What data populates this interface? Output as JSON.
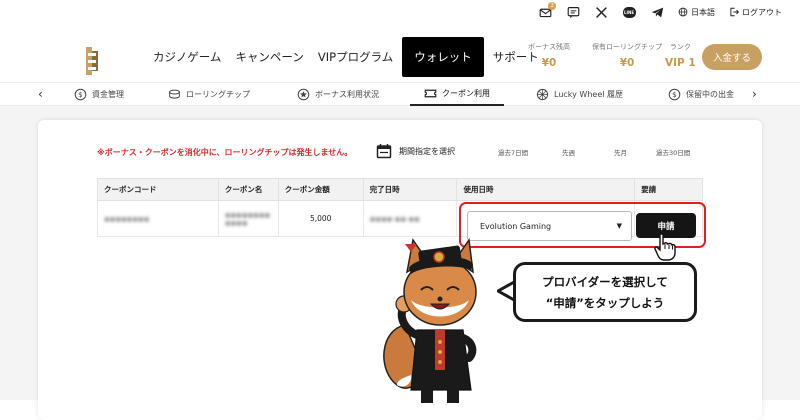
{
  "topbar": {
    "mail_badge": "3",
    "language_label": "日本語",
    "logout_label": "ログアウト"
  },
  "nav": {
    "items": [
      "カジノゲーム",
      "キャンペーン",
      "VIPプログラム",
      "ウォレット",
      "サポート"
    ],
    "active": "ウォレット"
  },
  "balances": {
    "bonus_credit": {
      "label": "ボーナス残高",
      "value": "¥0"
    },
    "rolling_chip": {
      "label": "保有ローリングチップ",
      "value": "¥0"
    },
    "rank": {
      "label": "ランク",
      "value": "VIP 1"
    }
  },
  "deposit_label": "入金する",
  "subnav": {
    "items": [
      "資金管理",
      "ローリングチップ",
      "ボーナス利用状況",
      "クーポン利用",
      "Lucky Wheel 履歴",
      "保留中の出金"
    ],
    "active": "クーポン利用"
  },
  "warning": "※ボーナス・クーポンを消化中に、ローリングチップは発生しません。",
  "period": {
    "label": "期間指定を選択",
    "options": [
      "過去7日間",
      "先週",
      "先月",
      "過去30日間"
    ]
  },
  "table": {
    "headers": [
      "クーポンコード",
      "クーポン名",
      "クーポン金額",
      "完了日時",
      "使用日時",
      "要請"
    ],
    "row": {
      "code": "●●●●●●●●",
      "name_line1": "●●●●●●●●",
      "name_line2": "●●●●",
      "amount": "5,000",
      "completed": "●●●●-●●-●●"
    }
  },
  "provider_select": "Evolution Gaming",
  "apply_label": "申請",
  "bubble": {
    "line1": "プロバイダーを選択して",
    "line2": "“申請”をタップしよう"
  },
  "colors": {
    "accent_gold": "#c9a063",
    "warning_red": "#d42a2a",
    "highlight_red": "#e02020",
    "nav_active_bg": "#000000"
  }
}
